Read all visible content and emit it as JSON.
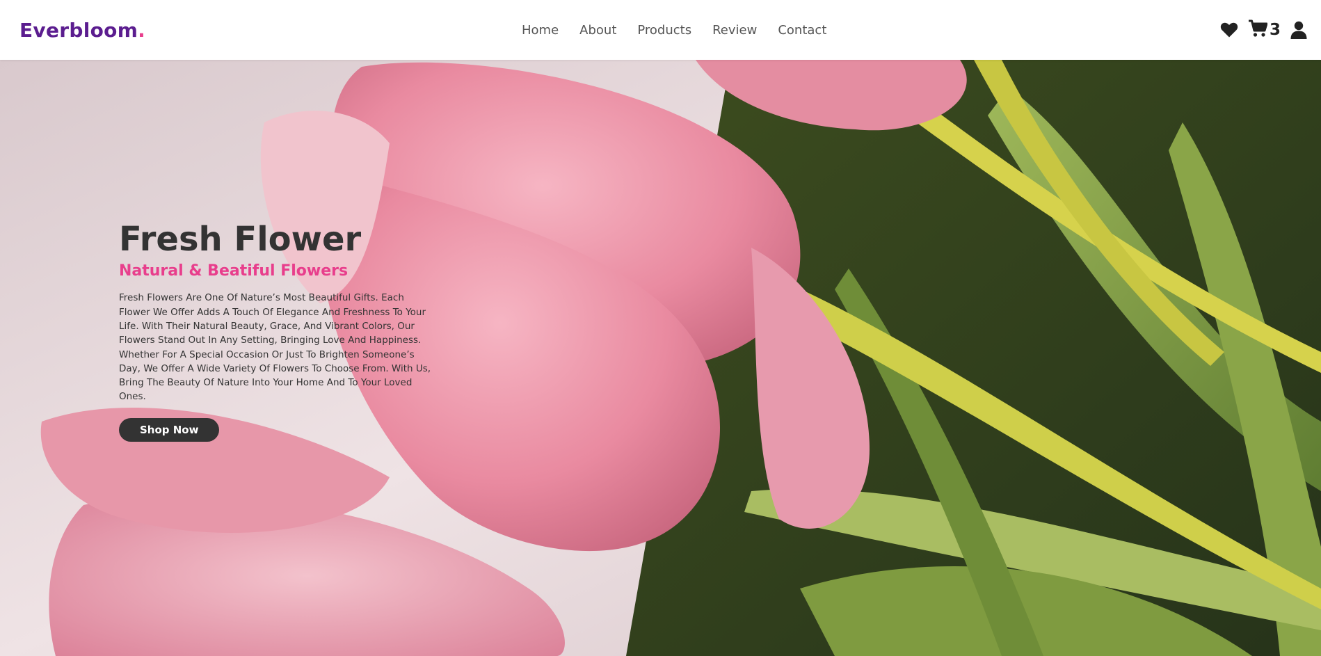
{
  "brand": {
    "name": "Everbloom",
    "dot": ".",
    "primary_color": "#5b1d8f",
    "accent_color": "#e83e8c"
  },
  "nav": {
    "items": [
      {
        "label": "Home"
      },
      {
        "label": "About"
      },
      {
        "label": "Products"
      },
      {
        "label": "Review"
      },
      {
        "label": "Contact"
      }
    ]
  },
  "header_icons": {
    "wishlist": "heart-icon",
    "cart": "cart-icon",
    "cart_count": "3",
    "account": "user-icon"
  },
  "hero": {
    "title": "Fresh Flower",
    "subtitle": "Natural & Beatiful Flowers",
    "description": "Fresh Flowers Are One Of Nature’s Most Beautiful Gifts. Each Flower We Offer Adds A Touch Of Elegance And Freshness To Your Life. With Their Natural Beauty, Grace, And Vibrant Colors, Our Flowers Stand Out In Any Setting, Bringing Love And Happiness. Whether For A Special Occasion Or Just To Brighten Someone’s Day, We Offer A Wide Variety Of Flowers To Choose From. With Us, Bring The Beauty Of Nature Into Your Home And To Your Loved Ones.",
    "cta_label": "Shop Now",
    "background_image": "pink-tulips-photo"
  }
}
